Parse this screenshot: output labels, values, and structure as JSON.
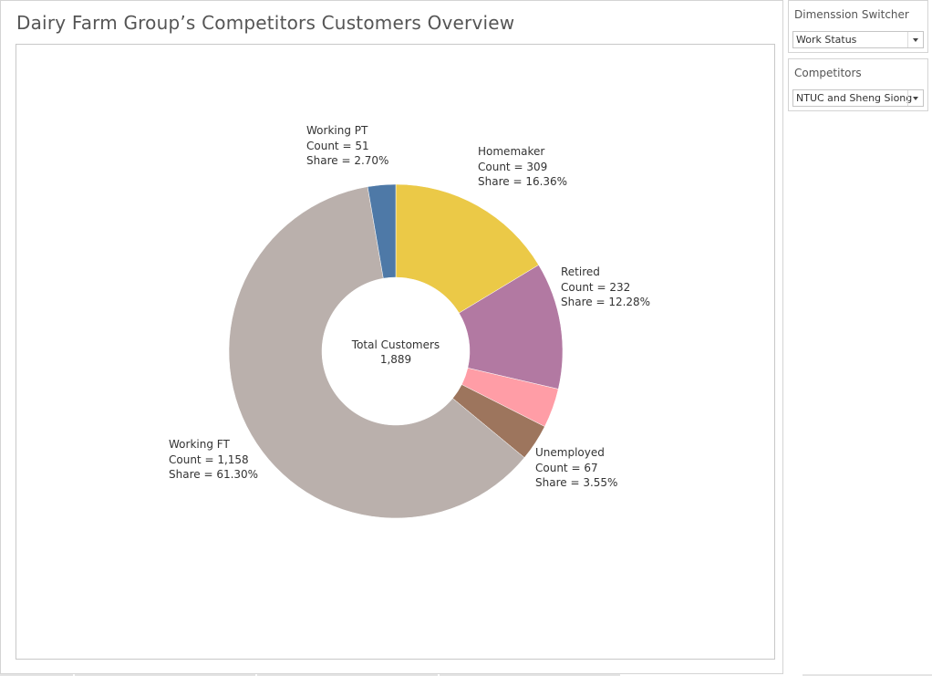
{
  "dashboard": {
    "title": "Dairy Farm Group’s Competitors Customers Overview"
  },
  "filters": {
    "dimension": {
      "title": "Dimenssion Switcher",
      "value": "Work Status"
    },
    "competitors": {
      "title": "Competitors",
      "value": "NTUC and Sheng Siong"
    }
  },
  "chart_data": {
    "type": "pie",
    "variant": "donut",
    "center": {
      "label": "Total Customers",
      "value": "1,889"
    },
    "slices": [
      {
        "name": "Homemaker",
        "count": 309,
        "count_text": "Count = 309",
        "share": 16.36,
        "share_text": "Share = 16.36%",
        "color": "#EBC947"
      },
      {
        "name": "Retired",
        "count": 232,
        "count_text": "Count = 232",
        "share": 12.28,
        "share_text": "Share = 12.28%",
        "color": "#B279A2"
      },
      {
        "name": "",
        "count": 72,
        "count_text": "",
        "share": 3.81,
        "share_text": "",
        "color": "#FF9DA6"
      },
      {
        "name": "Unemployed",
        "count": 67,
        "count_text": "Count = 67",
        "share": 3.55,
        "share_text": "Share = 3.55%",
        "color": "#9D755D"
      },
      {
        "name": "Working FT",
        "count": 1158,
        "count_text": "Count = 1,158",
        "share": 61.3,
        "share_text": "Share = 61.30%",
        "color": "#BAB0AC"
      },
      {
        "name": "Working PT",
        "count": 51,
        "count_text": "Count = 51",
        "share": 2.7,
        "share_text": "Share = 2.70%",
        "color": "#4E79A7"
      }
    ],
    "start_angle_deg": 0,
    "direction": "clockwise"
  }
}
